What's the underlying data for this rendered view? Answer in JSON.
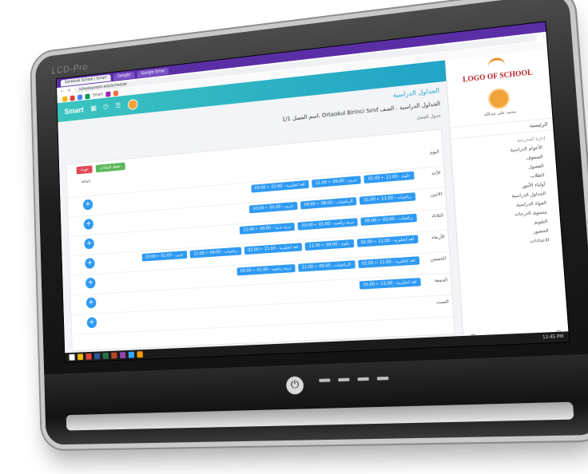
{
  "monitor": {
    "brand": "LCD-Pro"
  },
  "browser": {
    "tabs": [
      "Schedule School | Smart",
      "Google",
      "Google Drive"
    ],
    "url": "schoolsystem.edu/schedule",
    "bookmark_label": "Smart"
  },
  "app": {
    "logo": "Smart",
    "header_icons": [
      "grid-icon",
      "power-icon",
      "list-icon"
    ]
  },
  "sidebar": {
    "school_logo": "LOGO OF SCHOOL",
    "user_name": "محمد علي عبدالله",
    "home": "الرئيسية",
    "section": "إدارة المدرسة",
    "items": [
      "الأعوام الدراسية",
      "الصفوف",
      "الفصول",
      "الطلاب",
      "أولياء الأمور",
      "الجداول الدراسية",
      "المواد الدراسية",
      "مستوى الدرجات",
      "التقويم",
      "الحضور",
      "الاعدادات"
    ]
  },
  "main": {
    "page_title": "الجداول الدراسية",
    "subtitle": "الجداول الدراسية ، الصف Ortaokul Birinci Sınıf ،اسم الفصل 1/1",
    "table_label": "جدول الفصل",
    "buttons": {
      "save": "حفظ البيانات",
      "back": "عودة"
    },
    "add_label": "إضافة"
  },
  "schedule": [
    {
      "day": "اليوم",
      "slots": []
    },
    {
      "day": "الأحد",
      "slots": [
        "لغة انجليزية - 01:00 ⇠ 03:00",
        "عربي - 09:00 ⇠ 11:00",
        "علوم - 11:00 ⇠ 01:00"
      ]
    },
    {
      "day": "الاثنين",
      "slots": [
        "عربي - 01:00 ⇠ 03:00",
        "الرياضيات - 08:00 ⇠ 09:00",
        "رياضيات - 11:00 ⇠ 01:00"
      ]
    },
    {
      "day": "الثلاثاء",
      "slots": [
        "تربية بدنية - 09:00 ⇠ 11:00",
        "تربية رياضية - 01:00 ⇠ 03:00",
        "رياضيات - 03:00 ⇠ 05:00"
      ]
    },
    {
      "day": "الأربعاء",
      "slots": [
        "عربي - 01:00 ⇠ 03:00",
        "رياضيات - 09:00 ⇠ 11:00",
        "لغة انجليزية - 11:00 ⇠ 01:00",
        "علوم - 09:00 ⇠ 11:00",
        "لغة انجليزية - 11:00 ⇠ 01:00"
      ]
    },
    {
      "day": "الخميس",
      "slots": [
        "تربية رياضية - 01:00 ⇠ 03:00",
        "الرياضيات - 09:00 ⇠ 11:00",
        "لغة انجليزية - 11:00 ⇠ 01:00"
      ]
    },
    {
      "day": "الجمعة",
      "slots": [
        "لغة انجليزية - 11:00 ⇠ 01:00"
      ]
    },
    {
      "day": "السبت",
      "slots": []
    }
  ],
  "taskbar": {
    "time": "12:45 PM"
  },
  "colors": {
    "accent": "#21a3c7",
    "slot": "#2e9af2",
    "browser": "#5a2fa6"
  }
}
